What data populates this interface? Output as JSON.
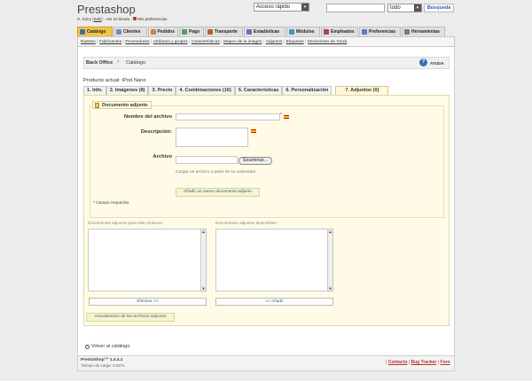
{
  "header": {
    "logo": "Prestashop",
    "user": {
      "name": "R. Baby",
      "logout": "Salir",
      "view_store": "Ver mi tienda",
      "preferences": "Mis preferencias"
    },
    "quick_access": "Acceso rápido",
    "search": {
      "scope": "todo",
      "button": "Búsqueda",
      "value": ""
    }
  },
  "tabs": [
    {
      "label": "Catálogo",
      "icon": "book-icon",
      "active": true
    },
    {
      "label": "Clientes",
      "icon": "user-icon"
    },
    {
      "label": "Pedidos",
      "icon": "cart-icon"
    },
    {
      "label": "Pago",
      "icon": "card-icon"
    },
    {
      "label": "Transporte",
      "icon": "truck-icon"
    },
    {
      "label": "Estadísticas",
      "icon": "chart-icon"
    },
    {
      "label": "Módulos",
      "icon": "puzzle-icon"
    },
    {
      "label": "Empleados",
      "icon": "employee-icon"
    },
    {
      "label": "Preferencias",
      "icon": "prefs-icon"
    },
    {
      "label": "Herramientas",
      "icon": "tools-icon"
    }
  ],
  "subnav": [
    "Rastreo",
    "Fabricantes",
    "Proveedores",
    "Atributos y grupos",
    "Características",
    "Mapeo de la imagen",
    "Adjuntos",
    "Etiquetas",
    "Movimiento de Stock"
  ],
  "breadcrumb": {
    "root": "Back Office",
    "current": "Catálogo",
    "help": "AYUDA"
  },
  "product": {
    "label": "Producto actual:",
    "name": "iPod Nano"
  },
  "product_tabs": [
    "1. Info.",
    "2. Imágenes (8)",
    "3. Precio",
    "4. Combinaciones (16)",
    "5. Características",
    "6. Personalización",
    "7. Adjuntos (0)"
  ],
  "form": {
    "legend": "Documento adjunto",
    "name_label": "Nombre del archivo",
    "name_value": "",
    "required_mark": "*",
    "desc_label": "Descripción:",
    "desc_value": "",
    "file_label": "Archivo",
    "file_value": "",
    "browse": "Examinar...",
    "hint": "Cargar un archivo a partir de su ordenador",
    "add_button": "Añadir un nuevo documento adjunto",
    "required_note": "* Campo requerido"
  },
  "attachments": {
    "attached_label": "Documentos adjuntos para este producto:",
    "available_label": "Documentos adjuntos disponibles:",
    "remove_button": "Eliminar >>",
    "add_button": "<< Añadir",
    "update_button": "Actualización de los archivos adjuntos"
  },
  "back_link": "Volver al catálogo",
  "footer": {
    "version": "PrestaShop™ 1.4.4.1",
    "load_time": "Tiempo de carga: 0.557s",
    "links": [
      "Contacto",
      "Bug Tracker",
      "Foro"
    ]
  }
}
